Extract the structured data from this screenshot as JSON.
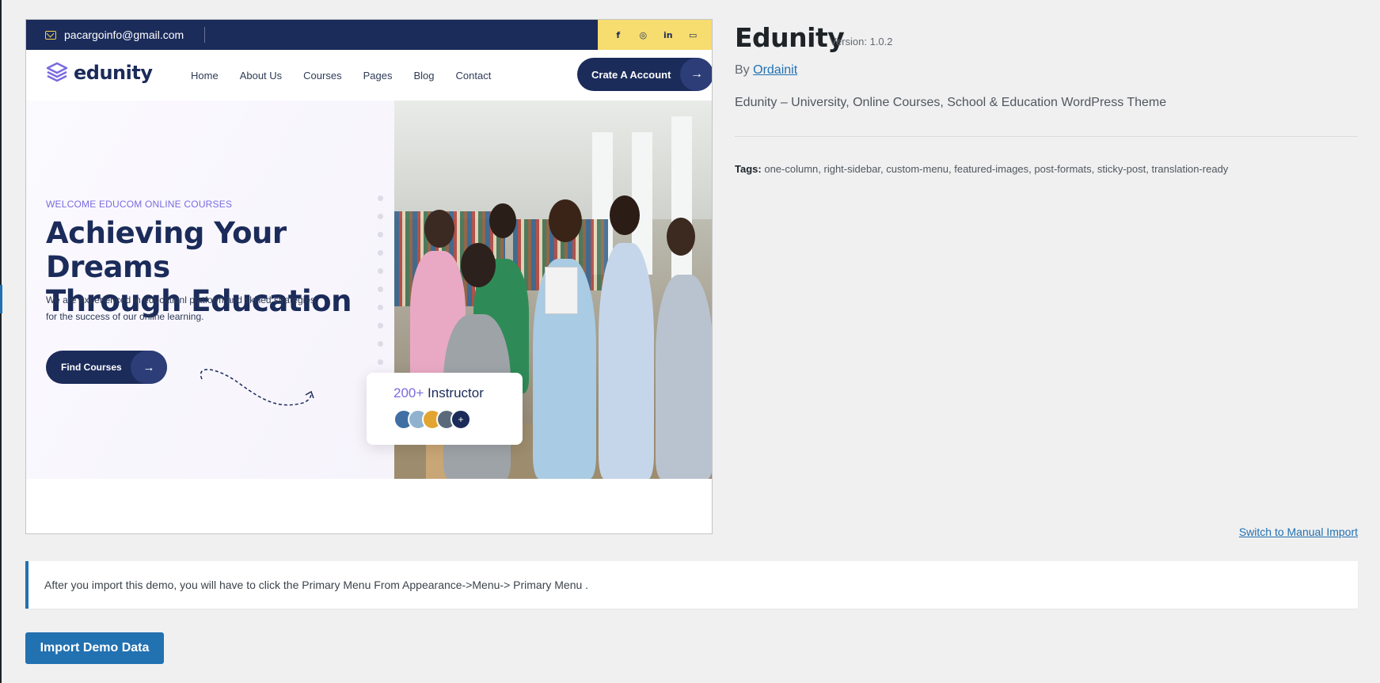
{
  "preview": {
    "email": "pacargoinfo@gmail.com",
    "social_icons": [
      "facebook-icon",
      "instagram-icon",
      "linkedin-icon",
      "youtube-icon"
    ],
    "logo_text": "edunity",
    "menu": [
      "Home",
      "About Us",
      "Courses",
      "Pages",
      "Blog",
      "Contact"
    ],
    "cta_label": "Crate A Account",
    "welcome": "WELCOME EDUCOM ONLINE COURSES",
    "headline_line1": "Achieving Your Dreams",
    "headline_line2": "Through Education",
    "sub_line1": "We are experienced in educationl platform and skilled strategies",
    "sub_line2": "for the success of our online learning.",
    "find_label": "Find Courses",
    "instructor_count": "200+",
    "instructor_label": "Instructor",
    "avatar_plus": "+",
    "colors": {
      "navy": "#1b2b5a",
      "purple": "#7a6be0",
      "yellow": "#f7dc6f"
    }
  },
  "theme": {
    "name": "Edunity",
    "version": "Version: 1.0.2",
    "by": "By",
    "author": "Ordainit",
    "description": "Edunity – University, Online Courses, School & Education WordPress Theme",
    "tags_label": "Tags:",
    "tags": "one-column, right-sidebar, custom-menu, featured-images, post-formats, sticky-post, translation-ready"
  },
  "switch_link": "Switch to Manual Import",
  "notice": "After you import this demo, you will have to click the Primary Menu From Appearance->Menu-> Primary Menu .",
  "import_button": "Import Demo Data",
  "colors": {
    "wp_blue": "#2271b1",
    "background": "#f0f0f1"
  }
}
